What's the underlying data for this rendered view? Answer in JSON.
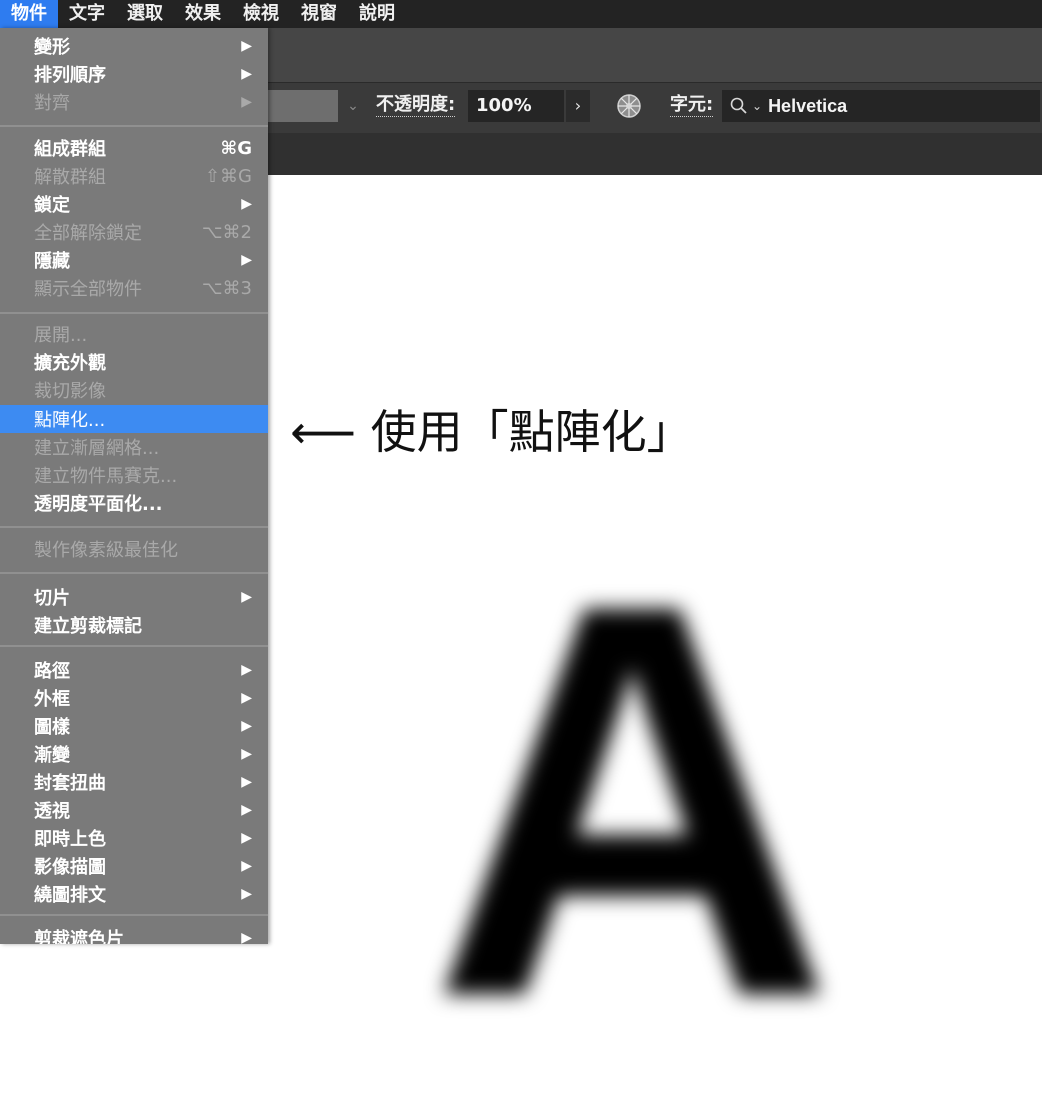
{
  "menubar": {
    "items": [
      {
        "label": "物件",
        "active": true
      },
      {
        "label": "文字"
      },
      {
        "label": "選取"
      },
      {
        "label": "效果"
      },
      {
        "label": "檢視"
      },
      {
        "label": "視窗"
      },
      {
        "label": "說明"
      }
    ]
  },
  "toolbar": {
    "opacity_label": "不透明度:",
    "opacity_value": "100%",
    "opacity_more": "›",
    "font_label": "字元:",
    "font_value": "Helvetica"
  },
  "menu": {
    "items": [
      {
        "label": "變形",
        "submenu": true,
        "enabled": true
      },
      {
        "label": "排列順序",
        "submenu": true,
        "enabled": true
      },
      {
        "label": "對齊",
        "submenu": true,
        "enabled": false
      },
      {
        "label": "組成群組",
        "shortcut": "⌘G",
        "enabled": true
      },
      {
        "label": "解散群組",
        "shortcut": "⇧⌘G",
        "enabled": false
      },
      {
        "label": "鎖定",
        "submenu": true,
        "enabled": true
      },
      {
        "label": "全部解除鎖定",
        "shortcut": "⌥⌘2",
        "enabled": false
      },
      {
        "label": "隱藏",
        "submenu": true,
        "enabled": true
      },
      {
        "label": "顯示全部物件",
        "shortcut": "⌥⌘3",
        "enabled": false
      },
      {
        "label": "展開...",
        "enabled": false
      },
      {
        "label": "擴充外觀",
        "enabled": true
      },
      {
        "label": "裁切影像",
        "enabled": false
      },
      {
        "label": "點陣化...",
        "enabled": true,
        "highlighted": true
      },
      {
        "label": "建立漸層網格...",
        "enabled": false
      },
      {
        "label": "建立物件馬賽克...",
        "enabled": false
      },
      {
        "label": "透明度平面化...",
        "enabled": true
      },
      {
        "label": "製作像素級最佳化",
        "enabled": false
      },
      {
        "label": "切片",
        "submenu": true,
        "enabled": true
      },
      {
        "label": "建立剪裁標記",
        "enabled": true
      },
      {
        "label": "路徑",
        "submenu": true,
        "enabled": true
      },
      {
        "label": "外框",
        "submenu": true,
        "enabled": true
      },
      {
        "label": "圖樣",
        "submenu": true,
        "enabled": true
      },
      {
        "label": "漸變",
        "submenu": true,
        "enabled": true
      },
      {
        "label": "封套扭曲",
        "submenu": true,
        "enabled": true
      },
      {
        "label": "透視",
        "submenu": true,
        "enabled": true
      },
      {
        "label": "即時上色",
        "submenu": true,
        "enabled": true
      },
      {
        "label": "影像描圖",
        "submenu": true,
        "enabled": true
      },
      {
        "label": "繞圖排文",
        "submenu": true,
        "enabled": true
      },
      {
        "label": "剪裁遮色片",
        "submenu": true,
        "enabled": true
      }
    ],
    "submenu_arrow": "▶"
  },
  "canvas": {
    "annotation": "⟵  使用「點陣化」",
    "sample_letter": "A"
  },
  "colors": {
    "menubar_bg": "#232323",
    "menu_bg": "#7a7a7a",
    "highlight": "#3d8bf2",
    "disabled_text": "#a9a9a9"
  }
}
